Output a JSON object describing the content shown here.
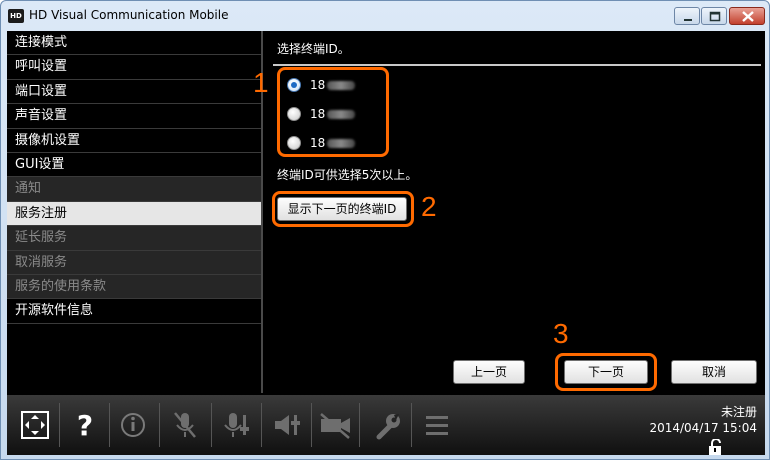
{
  "window": {
    "title": "HD Visual Communication Mobile",
    "app_icon_text": "HD"
  },
  "sidebar": {
    "items": [
      {
        "label": "连接模式",
        "state": "normal"
      },
      {
        "label": "呼叫设置",
        "state": "normal"
      },
      {
        "label": "端口设置",
        "state": "normal"
      },
      {
        "label": "声音设置",
        "state": "normal"
      },
      {
        "label": "摄像机设置",
        "state": "normal"
      },
      {
        "label": "GUI设置",
        "state": "normal"
      },
      {
        "label": "通知",
        "state": "dim"
      },
      {
        "label": "服务注册",
        "state": "active"
      },
      {
        "label": "延长服务",
        "state": "dim"
      },
      {
        "label": "取消服务",
        "state": "dim"
      },
      {
        "label": "服务的使用条款",
        "state": "dim"
      },
      {
        "label": "开源软件信息",
        "state": "normal"
      }
    ]
  },
  "main": {
    "prompt": "选择终端ID。",
    "terminal_ids": [
      {
        "label": "18",
        "selected": true
      },
      {
        "label": "18",
        "selected": false
      },
      {
        "label": "18",
        "selected": false
      }
    ],
    "note": "终端ID可供选择5次以上。",
    "show_next_ids_button": "显示下一页的终端ID",
    "prev_button": "上一页",
    "next_button": "下一页",
    "cancel_button": "取消"
  },
  "callouts": [
    "1",
    "2",
    "3"
  ],
  "accent_color": "#ff6a00",
  "toolbar": {
    "icons": [
      "layout-icon",
      "help-icon",
      "info-icon",
      "mic-mute-icon",
      "mic-level-icon",
      "speaker-level-icon",
      "camera-mute-icon",
      "wrench-icon",
      "menu-icon"
    ],
    "status": "未注册",
    "datetime": "2014/04/17 15:04"
  }
}
